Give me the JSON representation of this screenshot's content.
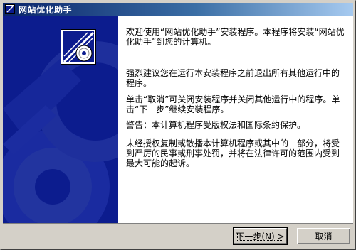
{
  "window": {
    "title": "网站优化助手",
    "accent_colors": {
      "titlebar_start": "#0a246a",
      "titlebar_end": "#a6caf0",
      "banner": "#0c1c8e"
    }
  },
  "content": {
    "paragraphs": [
      "欢迎使用“网站优化助手”安装程序。本程序将安装“网站优化助手”到您的计算机。",
      "强烈建议您在运行本安装程序之前退出所有其他运行中的程序。",
      "单击“取消”可关闭安装程序并关闭其他运行中的程序。单击“下一步”继续安装程序。",
      "警告：本计算机程序受版权法和国际条约保护。",
      "未经授权复制或散播本计算机程序或其中的一部分，将受到严厉的民事或刑事处罚，并将在法律许可的范围内受到最大可能的起诉。"
    ]
  },
  "buttons": {
    "next_label": "下一步(N) >",
    "cancel_label": "取消"
  },
  "icons": {
    "title_icon": "installer-icon",
    "banner_icon": "cd-installer-icon"
  }
}
